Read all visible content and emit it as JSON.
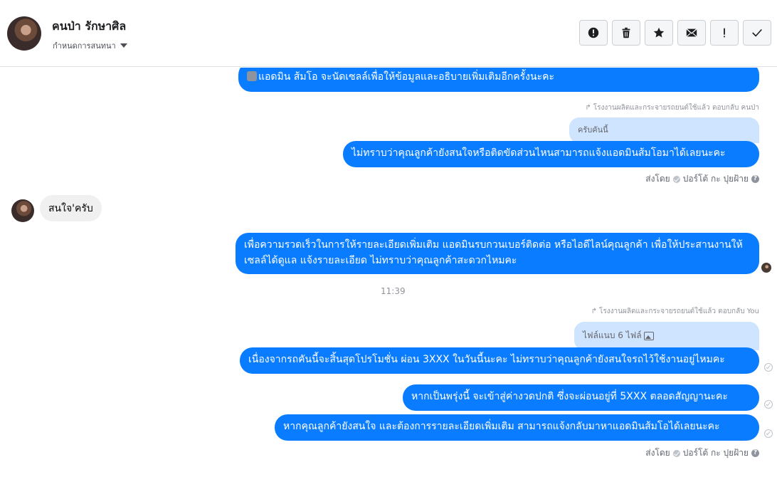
{
  "header": {
    "contact_name": "คนป่า รักษาศิล",
    "assign_label": "กำหนดการสนทนา",
    "toolbar": [
      {
        "name": "spam-button",
        "icon": "alert-circle-icon"
      },
      {
        "name": "delete-button",
        "icon": "trash-icon"
      },
      {
        "name": "star-button",
        "icon": "star-icon"
      },
      {
        "name": "mark-unread-button",
        "icon": "envelope-icon"
      },
      {
        "name": "follow-up-button",
        "icon": "exclamation-icon"
      },
      {
        "name": "done-button",
        "icon": "check-icon"
      }
    ]
  },
  "messages": {
    "m1": "แอดมิน ส้มโอ จะนัดเซลล์เพื่อให้ข้อมูลและอธิบายเพิ่มเติมอีกครั้งนะคะ",
    "reply1_meta": "โรงงานผลิตและกระจายรถยนต์ใช้แล้ว ตอบกลับ คนป่า",
    "reply1_quote": "ครับคันนี้",
    "m2": "ไม่ทราบว่าคุณลูกค้ายังสนใจหรือติดขัดส่วนไหนสามารถแจ้งแอดมินส้มโอมาได้เลยนะคะ",
    "sent_by_1": "ส่งโดย",
    "sender_1": "ปอร์โต้ กะ ปุยฝ้าย",
    "incoming1": "สนใจ'ครับ",
    "m3": "เพื่อความรวดเร็วในการให้รายละเอียดเพิ่มเติม แอดมินรบกวนเบอร์ติดต่อ หรือไอดีไลน์คุณลูกค้า เพื่อให้ประสานงานให้เซลล์ได้ดูแล แจ้งรายละเอียด ไม่ทราบว่าคุณลูกค้าสะดวกไหมคะ",
    "time": "11:39",
    "reply2_meta": "โรงงานผลิตและกระจายรถยนต์ใช้แล้ว ตอบกลับ You",
    "reply2_quote": "ไฟล์แนบ 6 ไฟล์",
    "m4": "เนื่องจากรถคันนี้จะสิ้นสุดโปรโมชั่น ผ่อน 3XXX ในวันนี้นะคะ ไม่ทราบว่าคุณลูกค้ายังสนใจรถไว้ใช้งานอยู่ไหมคะ",
    "m5": "หากเป็นพรุ่งนี้ จะเข้าสู่ค่างวดปกติ ซึ่งจะผ่อนอยู่ที่ 5XXX ตลอดสัญญานะคะ",
    "m6": "หากคุณลูกค้ายังสนใจ และต้องการรายละเอียดเพิ่มเติม สามารถแจ้งกลับมาหาแอดมินส้มโอได้เลยนะคะ",
    "sent_by_2": "ส่งโดย",
    "sender_2": "ปอร์โต้ กะ ปุยฝ้าย"
  },
  "colors": {
    "accent": "#0a7cff",
    "reply_bg": "#cfe4ff",
    "incoming_bg": "#f0f0f0"
  }
}
